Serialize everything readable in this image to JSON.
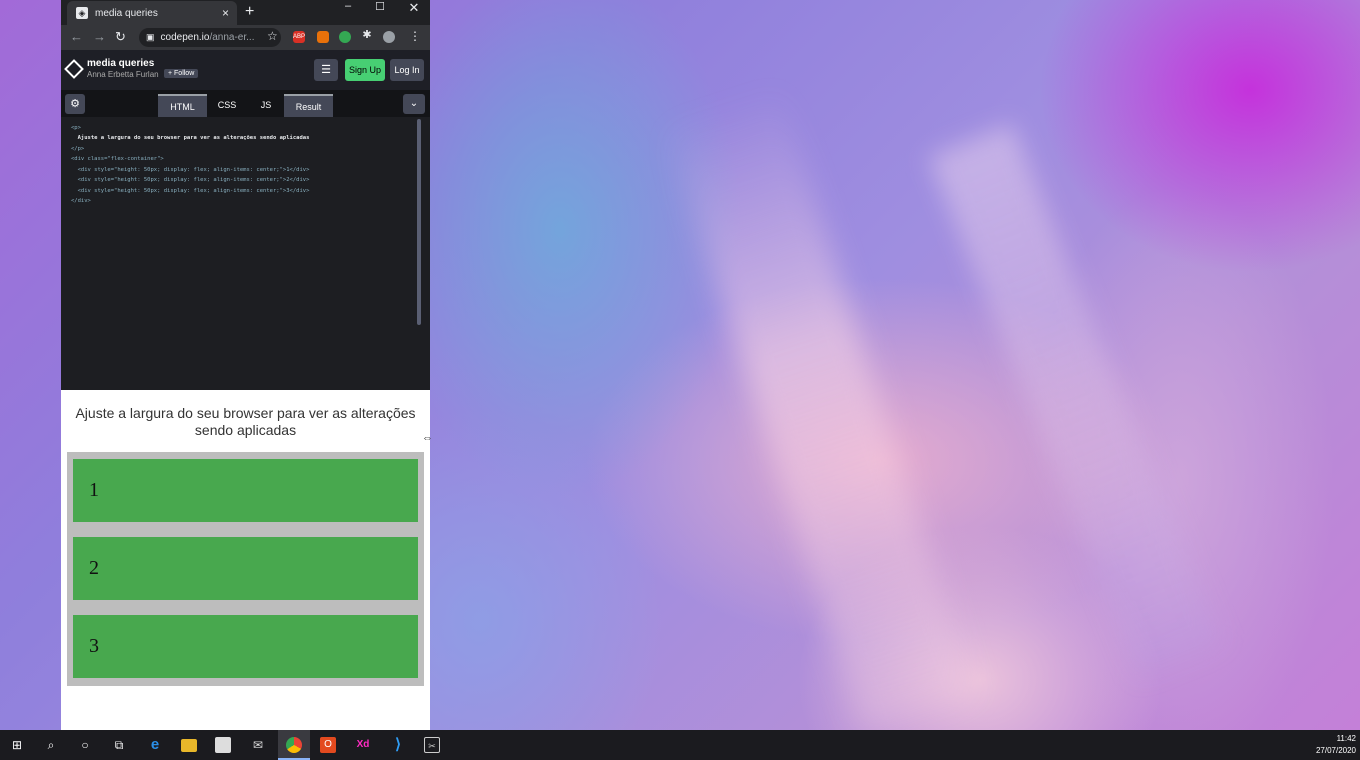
{
  "browser": {
    "tab_title": "media queries",
    "tab_favicon": "codepen-icon",
    "tab_close": "×",
    "new_tab": "+",
    "win_min": "–",
    "win_max": "☐",
    "win_close": "✕",
    "url_main": "codepen.io",
    "url_rest": "/anna-er...",
    "lock_icon": "🔒",
    "back": "←",
    "forward": "→",
    "reload": "↻",
    "star": "☆",
    "ext_abp": "ABP",
    "menu": "⋮"
  },
  "codepen": {
    "title": "media queries",
    "author": "Anna Erbetta Furlan",
    "follow": "+ Follow",
    "layout_icon": "☰",
    "signup": "Sign Up",
    "login": "Log In",
    "gear": "⚙",
    "tabs": [
      "HTML",
      "CSS",
      "JS",
      "Result"
    ],
    "collapse": "⌄",
    "code_lines": [
      "<p>",
      "  Ajuste a largura do seu browser para ver as alterações sendo aplicadas",
      "</p>",
      "<div class=\"flex-container\">",
      "  <div style=\"height: 50px; display: flex; align-items: center;\">1</div>",
      "  <div style=\"height: 50px; display: flex; align-items: center;\">2</div>",
      "  <div style=\"height: 50px; display: flex; align-items: center;\">3</div>",
      "</div>"
    ]
  },
  "result": {
    "text": "Ajuste a largura do seu browser para ver as alterações sendo aplicadas",
    "items": [
      "1",
      "2",
      "3"
    ],
    "item_color": "#48a84e",
    "container_color": "#bdbdbd"
  },
  "cursor": "⇔",
  "taskbar": {
    "start": "⊞",
    "search": "⌕",
    "cortana": "○",
    "taskview": "⧉",
    "edge": "e",
    "mail": "✉",
    "office": "O",
    "xd": "Xd",
    "vscode": "⟩",
    "snip": "✂",
    "time": "11:42",
    "date": "27/07/2020"
  },
  "colors": {
    "codepen_green": "#47cf73",
    "editor_bg": "#1d1e22"
  }
}
